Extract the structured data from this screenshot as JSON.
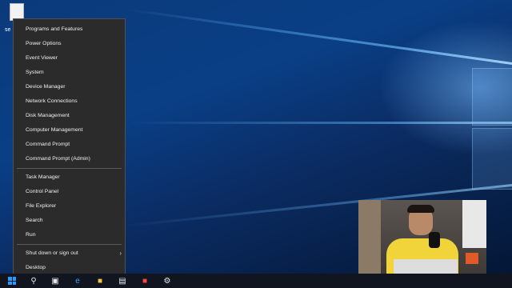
{
  "desktop": {
    "icon_label": "se"
  },
  "menu": {
    "groups": [
      [
        "Programs and Features",
        "Power Options",
        "Event Viewer",
        "System",
        "Device Manager",
        "Network Connections",
        "Disk Management",
        "Computer Management",
        "Command Prompt",
        "Command Prompt (Admin)"
      ],
      [
        "Task Manager",
        "Control Panel",
        "File Explorer",
        "Search",
        "Run"
      ],
      [
        "Shut down or sign out",
        "Desktop"
      ]
    ],
    "submenu_indicator": "›"
  },
  "taskbar": {
    "icons": [
      "start-icon",
      "search-icon",
      "task-view-icon",
      "edge-icon",
      "file-explorer-icon",
      "store-icon",
      "app-icon",
      "settings-icon"
    ]
  },
  "colors": {
    "menu_bg": "#2b2b2b",
    "taskbar_bg": "#101520",
    "wallpaper_blue": "#0a3f86"
  }
}
